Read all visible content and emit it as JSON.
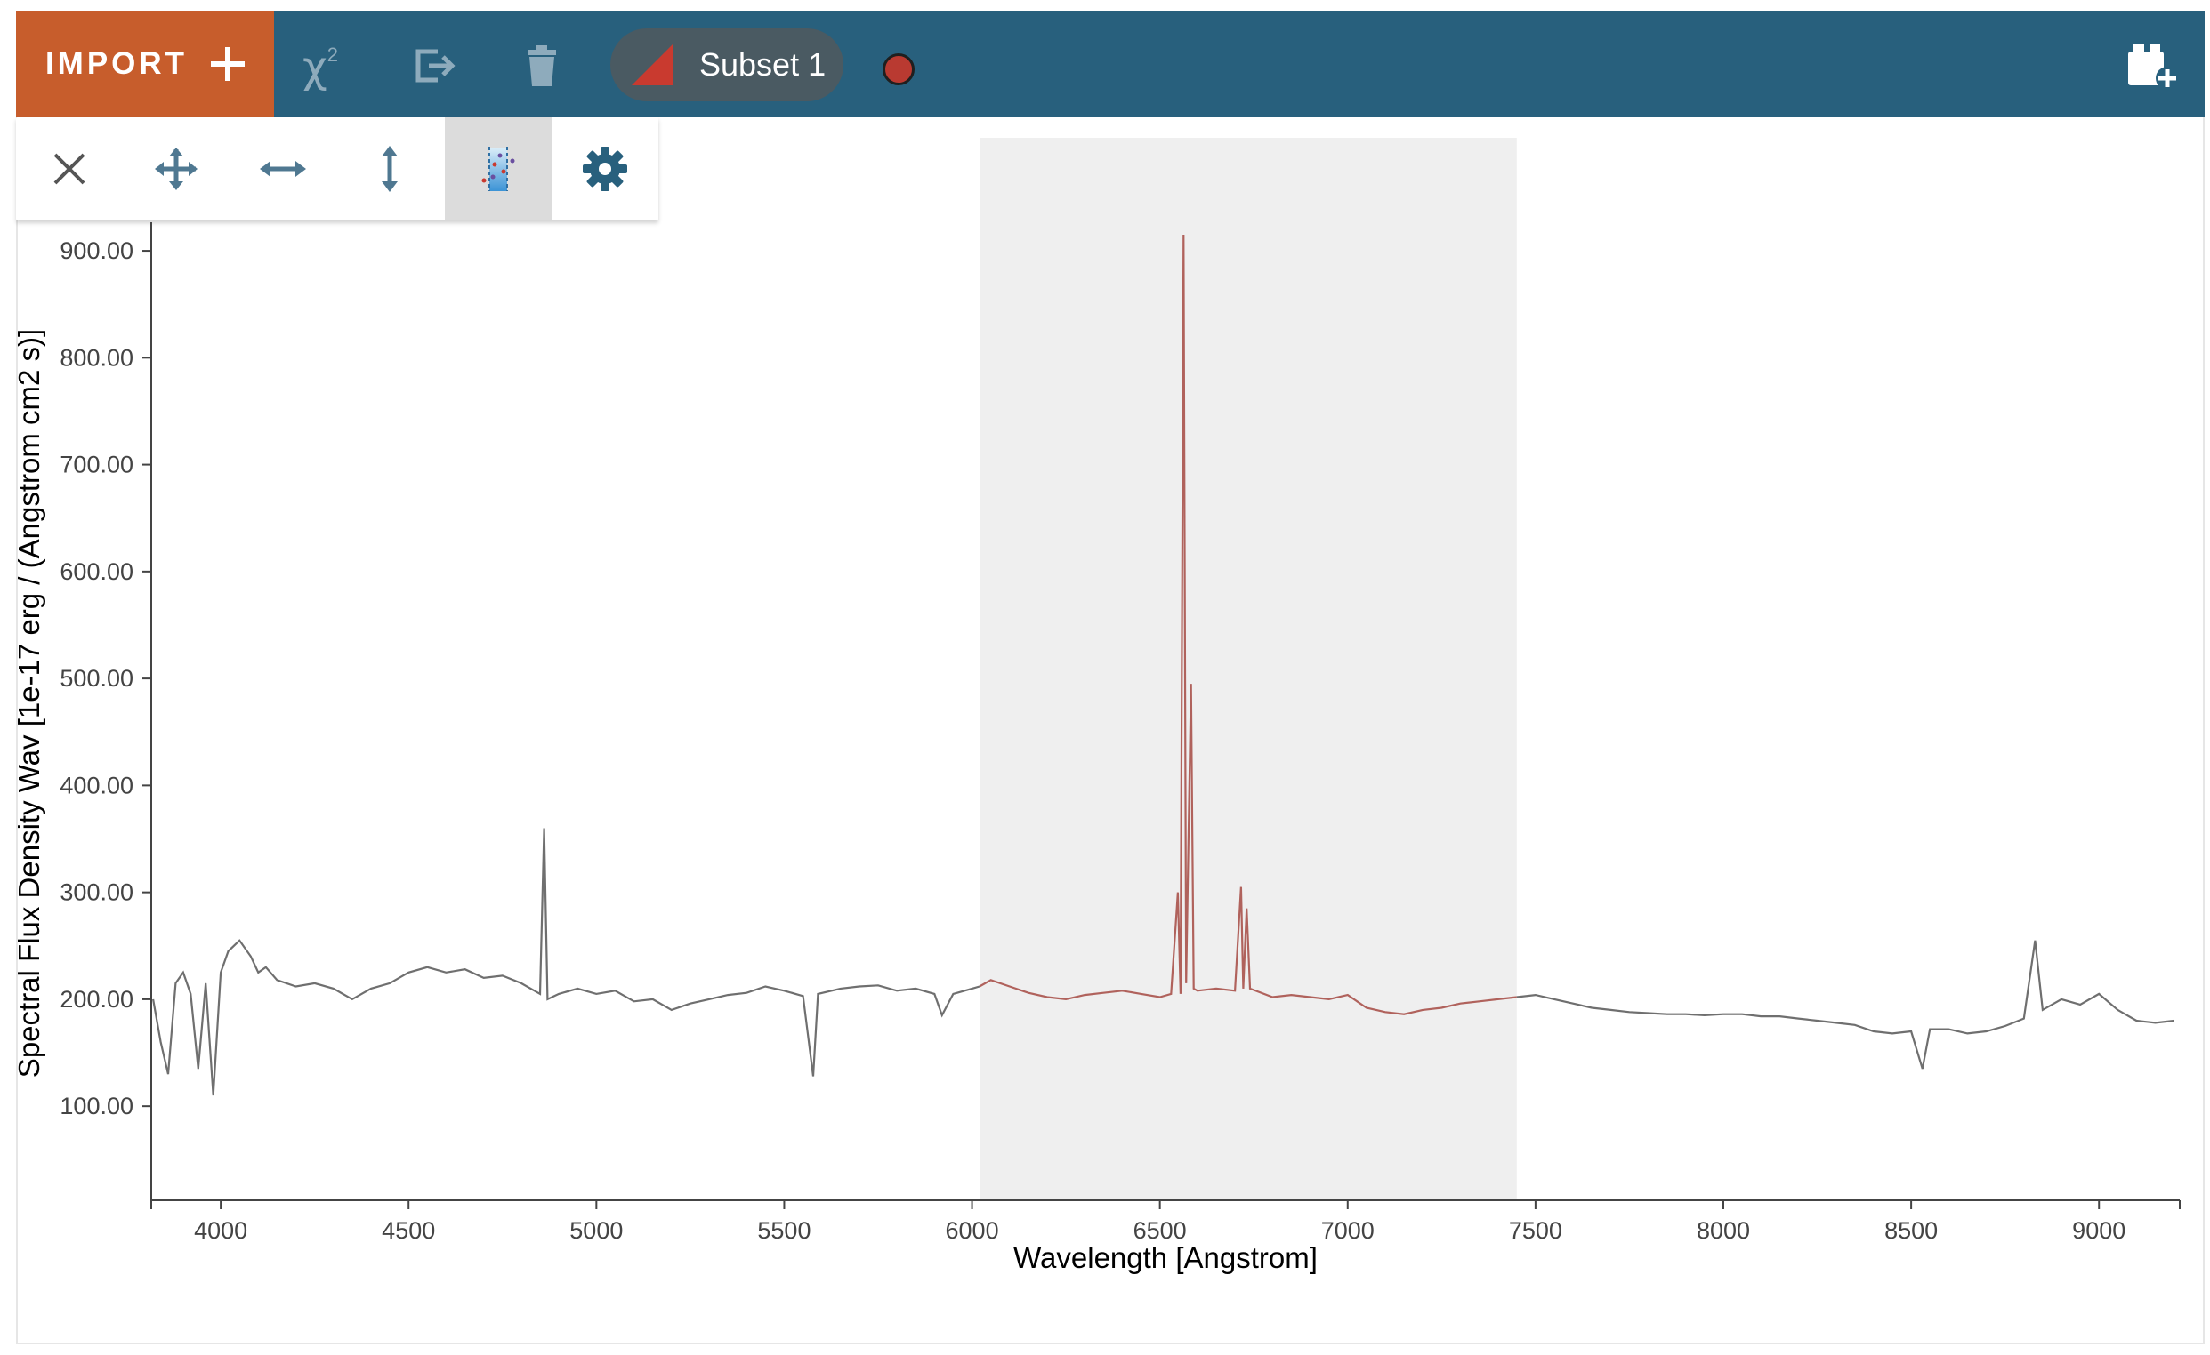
{
  "toolbar_top": {
    "import_label": "IMPORT",
    "import_icon": "plus-icon",
    "chi2_label": "χ",
    "chi2_sup": "2",
    "export_icon": "export-icon",
    "delete_icon": "trash-icon",
    "subset_label": "Subset 1",
    "subset_color": "#c93a2f",
    "record_color": "#b93a31",
    "viewer_add_icon": "add-viewer-icon"
  },
  "plot_tools": [
    {
      "icon": "close-icon"
    },
    {
      "icon": "pan-zoom-icon"
    },
    {
      "icon": "pan-horizontal-icon"
    },
    {
      "icon": "pan-vertical-icon"
    },
    {
      "icon": "spectral-select-icon",
      "active": true
    },
    {
      "icon": "settings-gear-icon"
    }
  ],
  "colors": {
    "appbar": "#28607d",
    "import": "#c75d2c",
    "spectrum": "#6f6f6f",
    "subset_line": "#b0625c",
    "subset_region": "#efefef"
  },
  "chart_data": {
    "type": "line",
    "xlabel": "Wavelength [Angstrom]",
    "ylabel": "Spectral Flux Density Wav [1e-17 erg / (Angstrom cm2 s)]",
    "xlim": [
      3815,
      9215
    ],
    "ylim": [
      12,
      925
    ],
    "x_ticks": [
      "4000",
      "4500",
      "5000",
      "5500",
      "6000",
      "6500",
      "7000",
      "7500",
      "8000",
      "8500",
      "9000"
    ],
    "y_ticks": [
      "100.00",
      "200.00",
      "300.00",
      "400.00",
      "500.00",
      "600.00",
      "700.00",
      "800.00",
      "900.00"
    ],
    "subset_range": [
      6020,
      7450
    ],
    "series": [
      {
        "points": [
          [
            3820,
            200
          ],
          [
            3840,
            160
          ],
          [
            3860,
            130
          ],
          [
            3880,
            215
          ],
          [
            3900,
            225
          ],
          [
            3920,
            205
          ],
          [
            3940,
            135
          ],
          [
            3960,
            215
          ],
          [
            3980,
            110
          ],
          [
            4000,
            225
          ],
          [
            4020,
            245
          ],
          [
            4050,
            255
          ],
          [
            4080,
            240
          ],
          [
            4100,
            225
          ],
          [
            4120,
            230
          ],
          [
            4150,
            218
          ],
          [
            4200,
            212
          ],
          [
            4250,
            215
          ],
          [
            4300,
            210
          ],
          [
            4350,
            200
          ],
          [
            4400,
            210
          ],
          [
            4450,
            215
          ],
          [
            4500,
            225
          ],
          [
            4550,
            230
          ],
          [
            4600,
            225
          ],
          [
            4650,
            228
          ],
          [
            4700,
            220
          ],
          [
            4750,
            222
          ],
          [
            4800,
            215
          ],
          [
            4850,
            205
          ],
          [
            4861,
            360
          ],
          [
            4870,
            200
          ],
          [
            4900,
            205
          ],
          [
            4950,
            210
          ],
          [
            5000,
            205
          ],
          [
            5050,
            208
          ],
          [
            5100,
            198
          ],
          [
            5150,
            200
          ],
          [
            5200,
            190
          ],
          [
            5250,
            196
          ],
          [
            5300,
            200
          ],
          [
            5350,
            204
          ],
          [
            5400,
            206
          ],
          [
            5450,
            212
          ],
          [
            5500,
            208
          ],
          [
            5550,
            203
          ],
          [
            5577,
            128
          ],
          [
            5590,
            205
          ],
          [
            5650,
            210
          ],
          [
            5700,
            212
          ],
          [
            5750,
            213
          ],
          [
            5800,
            208
          ],
          [
            5850,
            210
          ],
          [
            5900,
            205
          ],
          [
            5920,
            185
          ],
          [
            5950,
            205
          ],
          [
            6000,
            210
          ],
          [
            6020,
            212
          ]
        ]
      },
      {
        "points": [
          [
            6020,
            212
          ],
          [
            6050,
            218
          ],
          [
            6100,
            212
          ],
          [
            6150,
            206
          ],
          [
            6200,
            202
          ],
          [
            6250,
            200
          ],
          [
            6300,
            204
          ],
          [
            6350,
            206
          ],
          [
            6400,
            208
          ],
          [
            6450,
            205
          ],
          [
            6500,
            202
          ],
          [
            6530,
            205
          ],
          [
            6548,
            300
          ],
          [
            6555,
            205
          ],
          [
            6563,
            915
          ],
          [
            6570,
            215
          ],
          [
            6583,
            495
          ],
          [
            6590,
            210
          ],
          [
            6600,
            208
          ],
          [
            6650,
            210
          ],
          [
            6700,
            208
          ],
          [
            6716,
            305
          ],
          [
            6722,
            210
          ],
          [
            6731,
            285
          ],
          [
            6740,
            210
          ],
          [
            6800,
            202
          ],
          [
            6850,
            204
          ],
          [
            6900,
            202
          ],
          [
            6950,
            200
          ],
          [
            7000,
            204
          ],
          [
            7050,
            192
          ],
          [
            7100,
            188
          ],
          [
            7150,
            186
          ],
          [
            7200,
            190
          ],
          [
            7250,
            192
          ],
          [
            7300,
            196
          ],
          [
            7350,
            198
          ],
          [
            7400,
            200
          ],
          [
            7450,
            202
          ]
        ]
      },
      {
        "points": [
          [
            7450,
            202
          ],
          [
            7500,
            204
          ],
          [
            7550,
            200
          ],
          [
            7600,
            196
          ],
          [
            7650,
            192
          ],
          [
            7700,
            190
          ],
          [
            7750,
            188
          ],
          [
            7800,
            187
          ],
          [
            7850,
            186
          ],
          [
            7900,
            186
          ],
          [
            7950,
            185
          ],
          [
            8000,
            186
          ],
          [
            8050,
            186
          ],
          [
            8100,
            184
          ],
          [
            8150,
            184
          ],
          [
            8200,
            182
          ],
          [
            8250,
            180
          ],
          [
            8300,
            178
          ],
          [
            8350,
            176
          ],
          [
            8400,
            170
          ],
          [
            8450,
            168
          ],
          [
            8500,
            170
          ],
          [
            8530,
            135
          ],
          [
            8550,
            172
          ],
          [
            8600,
            172
          ],
          [
            8650,
            168
          ],
          [
            8700,
            170
          ],
          [
            8750,
            175
          ],
          [
            8800,
            182
          ],
          [
            8830,
            255
          ],
          [
            8850,
            190
          ],
          [
            8900,
            200
          ],
          [
            8950,
            195
          ],
          [
            9000,
            205
          ],
          [
            9050,
            190
          ],
          [
            9100,
            180
          ],
          [
            9150,
            178
          ],
          [
            9200,
            180
          ]
        ]
      }
    ]
  }
}
